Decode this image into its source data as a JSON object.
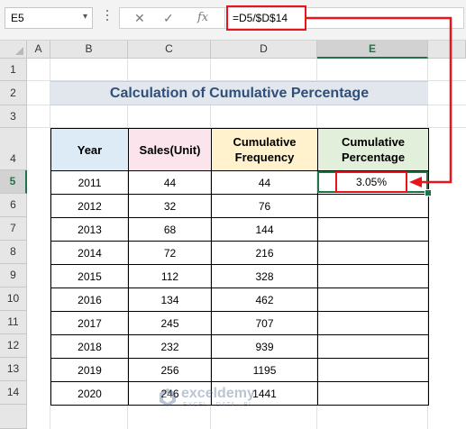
{
  "name_box": {
    "value": "E5"
  },
  "formula_bar": {
    "cancel_icon": "cancel-icon",
    "enter_icon": "check-icon",
    "fx_label": "fx",
    "formula": "=D5/$D$14"
  },
  "columns": [
    "A",
    "B",
    "C",
    "D",
    "E"
  ],
  "rows": [
    "1",
    "2",
    "3",
    "4",
    "5",
    "6",
    "7",
    "8",
    "9",
    "10",
    "11",
    "12",
    "13",
    "14"
  ],
  "active_cell": {
    "column": "E",
    "row": "5"
  },
  "title": "Calculation of Cumulative Percentage",
  "table": {
    "headers": {
      "year": "Year",
      "sales": "Sales(Unit)",
      "freq": "Cumulative Frequency",
      "pct": "Cumulative Percentage"
    },
    "rows": [
      {
        "year": "2011",
        "sales": "44",
        "freq": "44",
        "pct": "3.05%"
      },
      {
        "year": "2012",
        "sales": "32",
        "freq": "76",
        "pct": ""
      },
      {
        "year": "2013",
        "sales": "68",
        "freq": "144",
        "pct": ""
      },
      {
        "year": "2014",
        "sales": "72",
        "freq": "216",
        "pct": ""
      },
      {
        "year": "2015",
        "sales": "112",
        "freq": "328",
        "pct": ""
      },
      {
        "year": "2016",
        "sales": "134",
        "freq": "462",
        "pct": ""
      },
      {
        "year": "2017",
        "sales": "245",
        "freq": "707",
        "pct": ""
      },
      {
        "year": "2018",
        "sales": "232",
        "freq": "939",
        "pct": ""
      },
      {
        "year": "2019",
        "sales": "256",
        "freq": "1195",
        "pct": ""
      },
      {
        "year": "2020",
        "sales": "246",
        "freq": "1441",
        "pct": ""
      }
    ]
  },
  "colors": {
    "highlight_red": "#e8141c",
    "selection_green": "#217346",
    "title_text": "#2f4f7a",
    "header_year": "#ddebf7",
    "header_sales": "#fce4ec",
    "header_freq": "#fff2cc",
    "header_pct": "#e2efda"
  },
  "watermark": {
    "brand": "exceldemy",
    "tag": "EXCEL · DATA · BI"
  }
}
